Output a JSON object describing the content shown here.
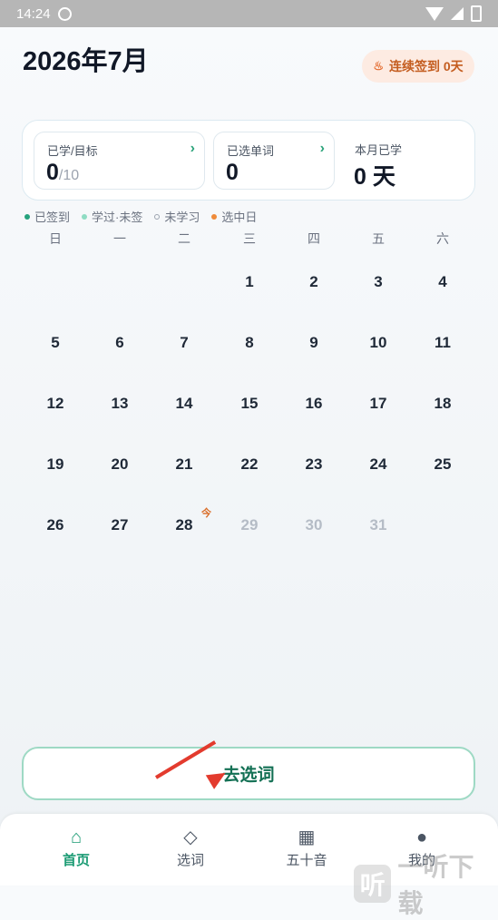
{
  "status_bar": {
    "time": "14:24"
  },
  "header": {
    "title": "2026年7月",
    "streak": "连续签到 0天"
  },
  "stats": {
    "learned_label": "已学/目标",
    "learned_value": "0",
    "learned_target": "/10",
    "selected_label": "已选单词",
    "selected_value": "0",
    "month_label": "本月已学",
    "month_value": "0 天"
  },
  "legend": [
    {
      "label": "已签到",
      "color": "#25a27d"
    },
    {
      "label": "学过·未签",
      "color": "#8fdcc3"
    },
    {
      "label": "未学习",
      "color": "#9ca3af"
    },
    {
      "label": "选中日",
      "color": "#ef8b3a"
    }
  ],
  "calendar": {
    "weekdays": [
      "日",
      "一",
      "二",
      "三",
      "四",
      "五",
      "六"
    ],
    "days": [
      "1",
      "2",
      "3",
      "4",
      "5",
      "6",
      "7",
      "8",
      "9",
      "10",
      "11",
      "12",
      "13",
      "14",
      "15",
      "16",
      "17",
      "18",
      "19",
      "20",
      "21",
      "22",
      "23",
      "24",
      "25",
      "26",
      "27",
      "28",
      "29",
      "30",
      "31"
    ],
    "today": "28",
    "today_mark": "今",
    "future_days": [
      "29",
      "30",
      "31"
    ]
  },
  "actions": {
    "go_select": "去选词"
  },
  "tabbar": {
    "home": "首页",
    "select": "选词",
    "kana": "五十音",
    "profile": "我的"
  },
  "watermark": "一听下载"
}
